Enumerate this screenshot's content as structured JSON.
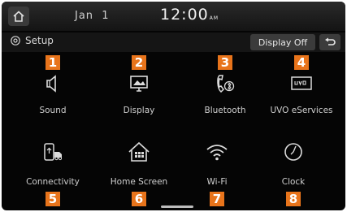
{
  "status": {
    "date": "Jan  1",
    "time": "12:00",
    "time_suffix": "AM"
  },
  "header": {
    "title": "Setup",
    "display_off_label": "Display Off"
  },
  "tiles": [
    {
      "label": "Sound",
      "badge": "1",
      "icon": "speaker-icon"
    },
    {
      "label": "Display",
      "badge": "2",
      "icon": "monitor-icon"
    },
    {
      "label": "Bluetooth",
      "badge": "3",
      "icon": "bluetooth-phone-icon"
    },
    {
      "label": "UVO eServices",
      "badge": "4",
      "icon": "uvo-icon"
    },
    {
      "label": "Connectivity",
      "badge": "5",
      "icon": "phone-car-icon"
    },
    {
      "label": "Home Screen",
      "badge": "6",
      "icon": "home-grid-icon"
    },
    {
      "label": "Wi-Fi",
      "badge": "7",
      "icon": "wifi-icon"
    },
    {
      "label": "Clock",
      "badge": "8",
      "icon": "clock-icon"
    }
  ],
  "colors": {
    "badge": "#e8741b",
    "background": "#050505",
    "text": "#cfcfcf"
  }
}
